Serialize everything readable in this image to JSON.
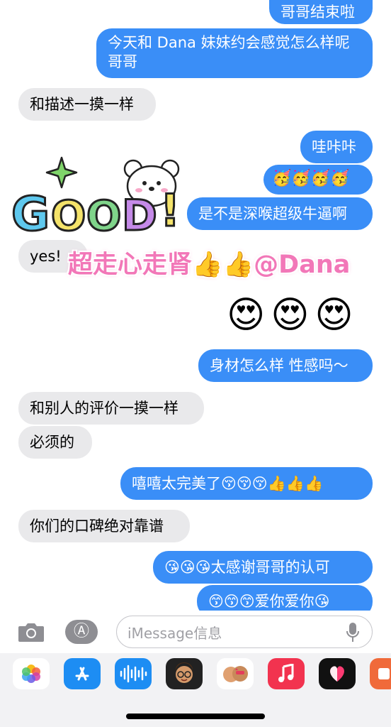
{
  "messages": [
    {
      "text": "哥哥结束啦"
    },
    {
      "line1": "今天和 Dana 妹妹约会感觉怎么样呢",
      "line2": "哥哥"
    },
    {
      "text": "和描述一摸一样"
    },
    {
      "text": "哇咔咔"
    },
    {
      "text": "🥳🥳🥳🥳"
    },
    {
      "text": "是不是深喉超级牛逼啊"
    },
    {
      "text": "yes!"
    },
    {
      "text": "😍😍😍"
    },
    {
      "text": "身材怎么样 性感吗～"
    },
    {
      "text": "和别人的评价一摸一样"
    },
    {
      "text": "必须的"
    },
    {
      "text": "嘻嘻太完美了😚😚😚👍👍👍"
    },
    {
      "text": "你们的口碑绝对靠谱"
    },
    {
      "text": "😘😘😘太感谢哥哥的认可"
    },
    {
      "text": "😙😙😙爱你爱你😘"
    }
  ],
  "sticker": {
    "good_text": "GOOD!",
    "caption": "超走心走肾👍👍@Dana",
    "colors": {
      "caption": "#f277b8",
      "g": "#5ec8ee",
      "o1": "#f4e36a",
      "o2": "#7fd48a",
      "d": "#c58ae8"
    }
  },
  "input": {
    "placeholder": "iMessage信息"
  },
  "tray": {
    "icons": [
      "photos-icon",
      "app-store-icon",
      "audio-icon",
      "memoji-icon",
      "memoji-stickers-icon",
      "music-icon",
      "digital-touch-icon",
      "extra-app-icon"
    ]
  },
  "colors": {
    "outgoing": "#3a8ef7",
    "incoming": "#e9e9eb"
  }
}
